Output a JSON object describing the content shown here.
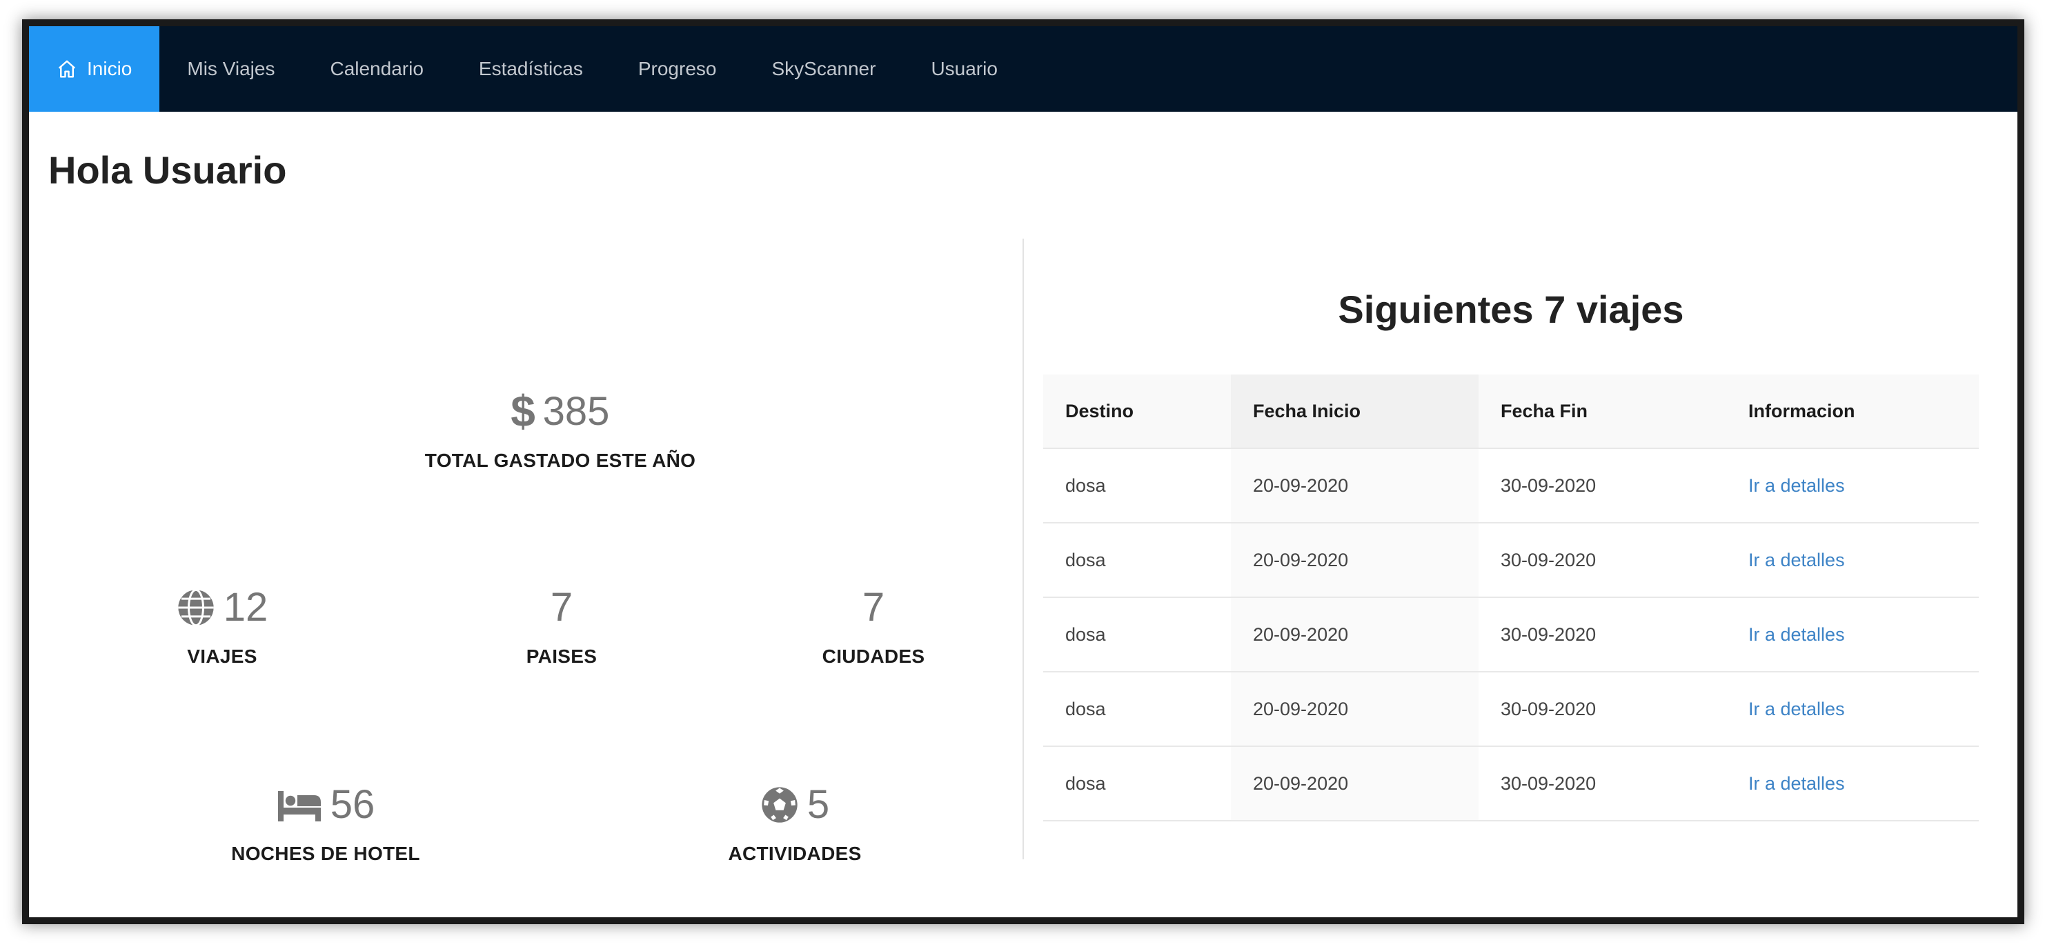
{
  "nav": {
    "items": [
      {
        "label": "Inicio",
        "icon": "home-icon",
        "active": true
      },
      {
        "label": "Mis Viajes"
      },
      {
        "label": "Calendario"
      },
      {
        "label": "Estadísticas"
      },
      {
        "label": "Progreso"
      },
      {
        "label": "SkyScanner"
      },
      {
        "label": "Usuario"
      }
    ],
    "active_color": "#2196f3",
    "bg_color": "#021427"
  },
  "page": {
    "title": "Hola Usuario"
  },
  "stats": {
    "total": {
      "value": "385",
      "label": "TOTAL GASTADO ESTE AÑO",
      "icon": "dollar-icon"
    },
    "viajes": {
      "value": "12",
      "label": "VIAJES",
      "icon": "globe-icon"
    },
    "paises": {
      "value": "7",
      "label": "PAISES"
    },
    "ciudades": {
      "value": "7",
      "label": "CIUDADES"
    },
    "hotel": {
      "value": "56",
      "label": "NOCHES DE HOTEL",
      "icon": "bed-icon"
    },
    "actividades": {
      "value": "5",
      "label": "ACTIVIDADES",
      "icon": "soccer-ball-icon"
    }
  },
  "trips": {
    "title": "Siguientes 7 viajes",
    "headers": [
      "Destino",
      "Fecha Inicio",
      "Fecha Fin",
      "Informacion"
    ],
    "rows": [
      {
        "destino": "dosa",
        "inicio": "20-09-2020",
        "fin": "30-09-2020",
        "info": "Ir a detalles"
      },
      {
        "destino": "dosa",
        "inicio": "20-09-2020",
        "fin": "30-09-2020",
        "info": "Ir a detalles"
      },
      {
        "destino": "dosa",
        "inicio": "20-09-2020",
        "fin": "30-09-2020",
        "info": "Ir a detalles"
      },
      {
        "destino": "dosa",
        "inicio": "20-09-2020",
        "fin": "30-09-2020",
        "info": "Ir a detalles"
      },
      {
        "destino": "dosa",
        "inicio": "20-09-2020",
        "fin": "30-09-2020",
        "info": "Ir a detalles"
      }
    ],
    "link_color": "#3d83c6"
  }
}
